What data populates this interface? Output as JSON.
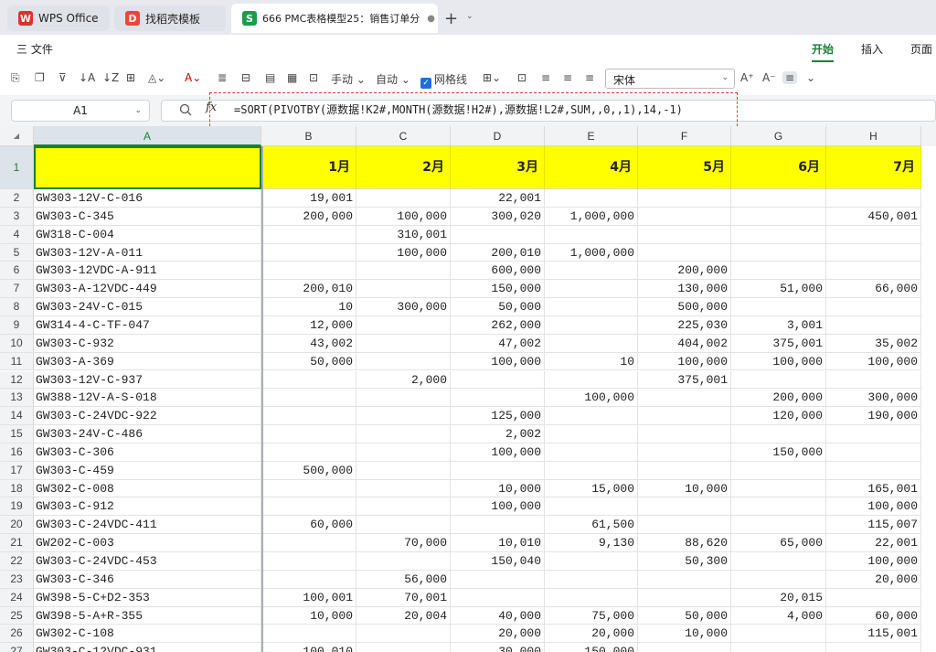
{
  "tabs": [
    {
      "label": "WPS Office",
      "logo": "W"
    },
    {
      "label": "找稻壳模板",
      "logo": "D"
    },
    {
      "label": "666 PMC表格模型25：销售订单分",
      "logo": "S"
    }
  ],
  "menu": {
    "file": "三 文件",
    "ribbon_tabs": [
      "开始",
      "插入",
      "页面"
    ]
  },
  "toolbar": {
    "manual": "手动",
    "auto": "自动",
    "gridlines": "网格线",
    "font": "宋体"
  },
  "formula_bar": {
    "cell_ref": "A1",
    "fx": "fx",
    "formula": "=SORT(PIVOTBY(源数据!K2#,MONTH(源数据!H2#),源数据!L2#,SUM,,0,,1),14,-1)"
  },
  "sheet": {
    "columns": [
      "A",
      "B",
      "C",
      "D",
      "E",
      "F",
      "G",
      "H"
    ],
    "months": [
      "1月",
      "2月",
      "3月",
      "4月",
      "5月",
      "6月",
      "7月"
    ],
    "rows": [
      {
        "n": "1"
      },
      {
        "n": "2",
        "code": "GW303-12V-C-016",
        "v": [
          "19,001",
          "",
          "22,001",
          "",
          "",
          "",
          ""
        ]
      },
      {
        "n": "3",
        "code": "GW303-C-345",
        "v": [
          "200,000",
          "100,000",
          "300,020",
          "1,000,000",
          "",
          "",
          "450,001"
        ]
      },
      {
        "n": "4",
        "code": "GW318-C-004",
        "v": [
          "",
          "310,001",
          "",
          "",
          "",
          "",
          ""
        ]
      },
      {
        "n": "5",
        "code": "GW303-12V-A-011",
        "v": [
          "",
          "100,000",
          "200,010",
          "1,000,000",
          "",
          "",
          ""
        ]
      },
      {
        "n": "6",
        "code": "GW303-12VDC-A-911",
        "v": [
          "",
          "",
          "600,000",
          "",
          "200,000",
          "",
          ""
        ]
      },
      {
        "n": "7",
        "code": "GW303-A-12VDC-449",
        "v": [
          "200,010",
          "",
          "150,000",
          "",
          "130,000",
          "51,000",
          "66,000"
        ]
      },
      {
        "n": "8",
        "code": "GW303-24V-C-015",
        "v": [
          "10",
          "300,000",
          "50,000",
          "",
          "500,000",
          "",
          ""
        ]
      },
      {
        "n": "9",
        "code": "GW314-4-C-TF-047",
        "v": [
          "12,000",
          "",
          "262,000",
          "",
          "225,030",
          "3,001",
          ""
        ]
      },
      {
        "n": "10",
        "code": "GW303-C-932",
        "v": [
          "43,002",
          "",
          "47,002",
          "",
          "404,002",
          "375,001",
          "35,002"
        ]
      },
      {
        "n": "11",
        "code": "GW303-A-369",
        "v": [
          "50,000",
          "",
          "100,000",
          "10",
          "100,000",
          "100,000",
          "100,000"
        ]
      },
      {
        "n": "12",
        "code": "GW303-12V-C-937",
        "v": [
          "",
          "2,000",
          "",
          "",
          "375,001",
          "",
          ""
        ]
      },
      {
        "n": "13",
        "code": "GW388-12V-A-S-018",
        "v": [
          "",
          "",
          "",
          "100,000",
          "",
          "200,000",
          "300,000"
        ]
      },
      {
        "n": "14",
        "code": "GW303-C-24VDC-922",
        "v": [
          "",
          "",
          "125,000",
          "",
          "",
          "120,000",
          "190,000"
        ]
      },
      {
        "n": "15",
        "code": "GW303-24V-C-486",
        "v": [
          "",
          "",
          "2,002",
          "",
          "",
          "",
          ""
        ]
      },
      {
        "n": "16",
        "code": "GW303-C-306",
        "v": [
          "",
          "",
          "100,000",
          "",
          "",
          "150,000",
          ""
        ]
      },
      {
        "n": "17",
        "code": "GW303-C-459",
        "v": [
          "500,000",
          "",
          "",
          "",
          "",
          "",
          ""
        ]
      },
      {
        "n": "18",
        "code": "GW302-C-008",
        "v": [
          "",
          "",
          "10,000",
          "15,000",
          "10,000",
          "",
          "165,001"
        ]
      },
      {
        "n": "19",
        "code": "GW303-C-912",
        "v": [
          "",
          "",
          "100,000",
          "",
          "",
          "",
          "100,000"
        ]
      },
      {
        "n": "20",
        "code": "GW303-C-24VDC-411",
        "v": [
          "60,000",
          "",
          "",
          "61,500",
          "",
          "",
          "115,007"
        ]
      },
      {
        "n": "21",
        "code": "GW202-C-003",
        "v": [
          "",
          "70,000",
          "10,010",
          "9,130",
          "88,620",
          "65,000",
          "22,001"
        ]
      },
      {
        "n": "22",
        "code": "GW303-C-24VDC-453",
        "v": [
          "",
          "",
          "150,040",
          "",
          "50,300",
          "",
          "100,000"
        ]
      },
      {
        "n": "23",
        "code": "GW303-C-346",
        "v": [
          "",
          "56,000",
          "",
          "",
          "",
          "",
          "20,000"
        ]
      },
      {
        "n": "24",
        "code": "GW398-5-C+D2-353",
        "v": [
          "100,001",
          "70,001",
          "",
          "",
          "",
          "20,015",
          ""
        ]
      },
      {
        "n": "25",
        "code": "GW398-5-A+R-355",
        "v": [
          "10,000",
          "20,004",
          "40,000",
          "75,000",
          "50,000",
          "4,000",
          "60,000"
        ]
      },
      {
        "n": "26",
        "code": "GW302-C-108",
        "v": [
          "",
          "",
          "20,000",
          "20,000",
          "10,000",
          "",
          "115,001"
        ]
      },
      {
        "n": "27",
        "code": "GW303-C-12VDC-931",
        "v": [
          "100,010",
          "",
          "30,000",
          "150,000",
          "",
          "",
          ""
        ]
      }
    ]
  },
  "colors": {
    "accent": "#1a7f37",
    "header_fill": "#ffff00",
    "highlight_border": "#e53935"
  }
}
